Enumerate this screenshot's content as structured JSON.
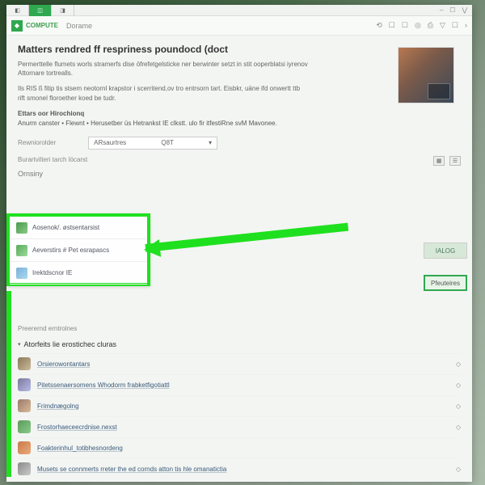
{
  "window": {
    "tabs": [
      "◧",
      "◫",
      "◨"
    ],
    "controls": [
      "–",
      "☐",
      "⋁"
    ]
  },
  "toolbar": {
    "brand_icon": "◆",
    "brand_text": "COMPUTE",
    "breadcrumb": "Dorame",
    "icons": [
      "⟲",
      "☐",
      "☐",
      "◎",
      "⎙",
      "▽",
      "☐",
      "›"
    ]
  },
  "hero": {
    "title": "Matters rendred ff respriness poundocd (doct",
    "desc1": "Permerttelle flumets worls stramerfs dise öfrefetgelsticke ner berwinter setzt in stit ooperblatsi iyrenov Attornare tortrealls.",
    "desc2": "Ils RIS ß fitip tis stsem neotornl krapstor i scerritend,ov tro entrsorn tart. Eisbkr, uäne ifd onwertt ttb rift smonel floroether koed be tudr.",
    "meta_title": "Ettars oor Hirochionq",
    "meta_line": "Anurm canster • Flewnt • Herusetber üs Hetrankst IE clkstt. ulo fir itfestiRne svM Mavonee.",
    "meta_footer": "Rewniorolder"
  },
  "field": {
    "label_left": "",
    "dropdown_label": "ARsaurtres",
    "dropdown_value": "Q8T"
  },
  "sections": {
    "sub1": "Burartvilteri tarch löcarst",
    "view_toggle1": "▦",
    "view_toggle2": "☰",
    "category": "Ornsiny"
  },
  "highlight_items": [
    {
      "color": "linear-gradient(135deg,#4a9a4a,#8aca8a)",
      "label": "Aosenok/. østsentarsist"
    },
    {
      "color": "linear-gradient(135deg,#5aaa5a,#9ada9a)",
      "label": "Aeverstirs # Pet esrapascs"
    },
    {
      "color": "linear-gradient(135deg,#7ab0da,#aadaf0)",
      "label": "Irektdscnor IE"
    }
  ],
  "side_buttons": {
    "b1": "IALOG",
    "b2": "Pfeuteires"
  },
  "lower": {
    "sub_section": "Preerernd erntrolnes",
    "expand_header": "Atorfeits lie erostichec cluras"
  },
  "list_items": [
    {
      "color": "linear-gradient(135deg,#8a7a5a,#cabb9a)",
      "label": "Orsierowontantars",
      "chk": "◇"
    },
    {
      "color": "linear-gradient(135deg,#7a7a9a,#babaea)",
      "label": "Pitetssenaersomens Whodorm frabketfigotiattl",
      "chk": "◇"
    },
    {
      "color": "linear-gradient(135deg,#9a7a6a,#daba9a)",
      "label": "Frimdnægolng",
      "chk": "◇"
    },
    {
      "color": "linear-gradient(135deg,#5a9a5a,#8aca8a)",
      "label": "Frostorhaeceecrdnise.nexst",
      "chk": "◇"
    },
    {
      "color": "linear-gradient(135deg,#ca7a4a,#eaaa7a)",
      "label": "Foakterinhul_totibhesnordeng",
      "chk": ""
    },
    {
      "color": "linear-gradient(135deg,#8a8a8a,#cacaca)",
      "label": "Musets se connmerts rreter the ed cornds atton tis hle omanatictia",
      "chk": "◇"
    }
  ]
}
